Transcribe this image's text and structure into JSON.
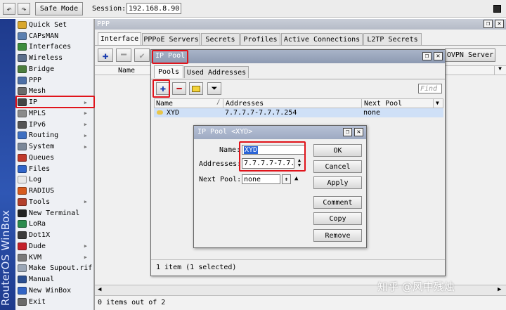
{
  "toolbar": {
    "safe_mode": "Safe Mode",
    "session_label": "Session:",
    "session_value": "192.168.8.90"
  },
  "brand": "RouterOS WinBox",
  "sidebar": {
    "items": [
      {
        "label": "Quick Set",
        "icon": "quickset-icon",
        "color": "#d9a72b"
      },
      {
        "label": "CAPsMAN",
        "icon": "capsman-icon",
        "color": "#5a7fb0"
      },
      {
        "label": "Interfaces",
        "icon": "interfaces-icon",
        "color": "#3c8c3c"
      },
      {
        "label": "Wireless",
        "icon": "wireless-icon",
        "color": "#5b6f8c"
      },
      {
        "label": "Bridge",
        "icon": "bridge-icon",
        "color": "#4b7d3d"
      },
      {
        "label": "PPP",
        "icon": "ppp-icon",
        "color": "#4d6fa5"
      },
      {
        "label": "Mesh",
        "icon": "mesh-icon",
        "color": "#6b6b6b"
      },
      {
        "label": "IP",
        "icon": "ip-icon",
        "color": "#444444"
      },
      {
        "label": "MPLS",
        "icon": "mpls-icon",
        "color": "#8a8a8a"
      },
      {
        "label": "IPv6",
        "icon": "ipv6-icon",
        "color": "#555555"
      },
      {
        "label": "Routing",
        "icon": "routing-icon",
        "color": "#3e6fc1"
      },
      {
        "label": "System",
        "icon": "system-icon",
        "color": "#7b8899"
      },
      {
        "label": "Queues",
        "icon": "queues-icon",
        "color": "#c0392b"
      },
      {
        "label": "Files",
        "icon": "files-icon",
        "color": "#2f64c9"
      },
      {
        "label": "Log",
        "icon": "log-icon",
        "color": "#e8e8e8"
      },
      {
        "label": "RADIUS",
        "icon": "radius-icon",
        "color": "#d65b1f"
      },
      {
        "label": "Tools",
        "icon": "tools-icon",
        "color": "#b3402c"
      },
      {
        "label": "New Terminal",
        "icon": "terminal-icon",
        "color": "#222222"
      },
      {
        "label": "LoRa",
        "icon": "lora-icon",
        "color": "#2a8a4c"
      },
      {
        "label": "Dot1X",
        "icon": "dot1x-icon",
        "color": "#3b3b3b"
      },
      {
        "label": "Dude",
        "icon": "dude-icon",
        "color": "#c4212b"
      },
      {
        "label": "KVM",
        "icon": "kvm-icon",
        "color": "#7a7a7a"
      },
      {
        "label": "Make Supout.rif",
        "icon": "supout-icon",
        "color": "#9aa6b6"
      },
      {
        "label": "Manual",
        "icon": "manual-icon",
        "color": "#2b4f91"
      },
      {
        "label": "New WinBox",
        "icon": "winbox-icon",
        "color": "#3264c4"
      },
      {
        "label": "Exit",
        "icon": "exit-icon",
        "color": "#6a6a6a"
      }
    ]
  },
  "ppp": {
    "title": "PPP",
    "tabs": [
      "Interface",
      "PPPoE Servers",
      "Secrets",
      "Profiles",
      "Active Connections",
      "L2TP Secrets"
    ],
    "ovpn_button": "OVPN Server",
    "col_name": "Name",
    "status": "0 items out of 2"
  },
  "pool": {
    "title": "IP Pool",
    "tabs": [
      "Pools",
      "Used Addresses"
    ],
    "find_placeholder": "Find",
    "columns": [
      "Name",
      "Addresses",
      "Next Pool"
    ],
    "row": {
      "name": "XYD",
      "addresses": "7.7.7.7-7.7.7.254",
      "next_pool": "none"
    },
    "status": "1 item (1 selected)"
  },
  "dialog": {
    "title": "IP Pool <XYD>",
    "name_label": "Name:",
    "name_value": "XYD",
    "addresses_label": "Addresses:",
    "addresses_value": "7.7.7.7-7.7.7",
    "nextpool_label": "Next Pool:",
    "nextpool_value": "none",
    "buttons": {
      "ok": "OK",
      "cancel": "Cancel",
      "apply": "Apply",
      "comment": "Comment",
      "copy": "Copy",
      "remove": "Remove"
    }
  },
  "watermark": "知乎 @风中残烛",
  "colors": {
    "highlight": "#e0141b",
    "selected_row": "#cfe0f7",
    "accent_blue": "#1d4fb8"
  }
}
